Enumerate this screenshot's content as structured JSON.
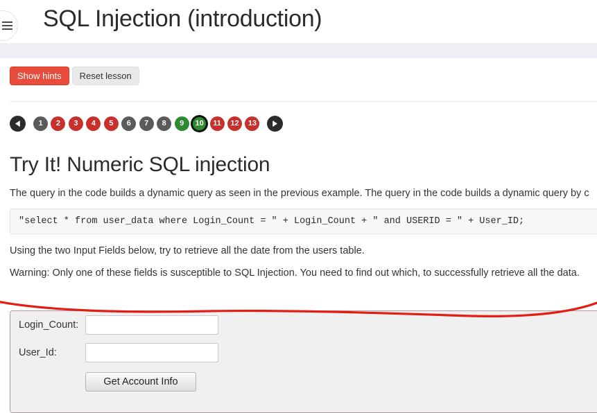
{
  "header": {
    "title": "SQL Injection (introduction)",
    "menu_icon": "hamburger-icon"
  },
  "controls": {
    "show_hints_label": "Show hints",
    "reset_lesson_label": "Reset lesson"
  },
  "pagination": {
    "prev_label": "◀",
    "next_label": "▶",
    "current": 10,
    "items": [
      {
        "number": "1",
        "state": "grey"
      },
      {
        "number": "2",
        "state": "red"
      },
      {
        "number": "3",
        "state": "red"
      },
      {
        "number": "4",
        "state": "red"
      },
      {
        "number": "5",
        "state": "red"
      },
      {
        "number": "6",
        "state": "grey"
      },
      {
        "number": "7",
        "state": "grey"
      },
      {
        "number": "8",
        "state": "grey"
      },
      {
        "number": "9",
        "state": "green"
      },
      {
        "number": "10",
        "state": "green"
      },
      {
        "number": "11",
        "state": "red"
      },
      {
        "number": "12",
        "state": "red"
      },
      {
        "number": "13",
        "state": "red"
      }
    ]
  },
  "lesson": {
    "heading": "Try It! Numeric SQL injection",
    "intro_paragraph": "The query in the code builds a dynamic query as seen in the previous example. The query in the code builds a dynamic query by c",
    "code_snippet": "\"select * from user_data where Login_Count = \" + Login_Count + \" and USERID = \"  + User_ID;",
    "instruction_paragraph": "Using the two Input Fields below, try to retrieve all the date from the users table.",
    "warning_paragraph": "Warning: Only one of these fields is susceptible to SQL Injection. You need to find out which, to successfully retrieve all the data."
  },
  "attack_form": {
    "login_count_label": "Login_Count:",
    "login_count_value": "",
    "user_id_label": "User_Id:",
    "user_id_value": "",
    "submit_label": "Get Account Info"
  },
  "colors": {
    "danger": "#e74c3c",
    "success": "#2d8a2d",
    "muted": "#5b5b5b",
    "page_red": "#c9302c",
    "band": "#eeeef5",
    "annotation": "#e51c12",
    "panel_border": "#b09a9f"
  }
}
